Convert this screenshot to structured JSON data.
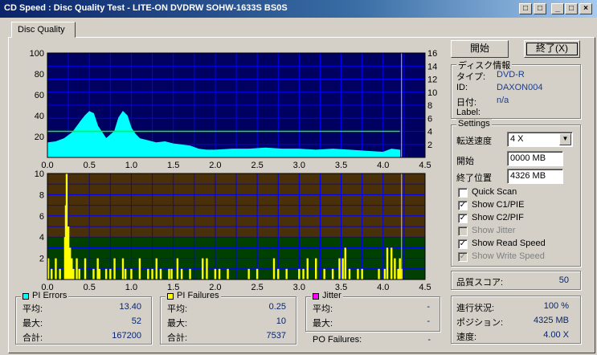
{
  "window": {
    "title": "CD Speed : Disc Quality Test - LITE-ON DVDRW SOHW-1633S BS0S",
    "controls": {
      "restore": "□",
      "minimize": "_",
      "maximize": "□",
      "close": "×"
    }
  },
  "tabs": [
    {
      "label": "Disc Quality"
    }
  ],
  "buttons": {
    "start": "開始",
    "end": "終了(X)"
  },
  "disc_info": {
    "title": "ディスク情報",
    "type_label": "タイプ:",
    "type_value": "DVD-R",
    "id_label": "ID:",
    "id_value": "DAXON004",
    "date_label": "日付:",
    "date_value": "n/a",
    "label_label": "Label:",
    "label_value": ""
  },
  "settings": {
    "title": "Settings",
    "speed_label": "転送速度",
    "speed_value": "4 X",
    "start_label": "開始",
    "start_value": "0000 MB",
    "end_label": "終了位置",
    "end_value": "4326 MB",
    "checkboxes": [
      {
        "label": "Quick Scan",
        "checked": false,
        "enabled": true
      },
      {
        "label": "Show C1/PIE",
        "checked": true,
        "enabled": true
      },
      {
        "label": "Show C2/PIF",
        "checked": true,
        "enabled": true
      },
      {
        "label": "Show Jitter",
        "checked": false,
        "enabled": false
      },
      {
        "label": "Show Read Speed",
        "checked": true,
        "enabled": true
      },
      {
        "label": "Show Write Speed",
        "checked": true,
        "enabled": false
      }
    ]
  },
  "quality": {
    "label": "品質スコア:",
    "value": "50"
  },
  "progress": {
    "progress_label": "進行状況:",
    "progress_value": "100 %",
    "position_label": "ポジション:",
    "position_value": "4325 MB",
    "speed_label": "速度:",
    "speed_value": "4.00 X"
  },
  "pi_errors": {
    "title": "PI Errors",
    "color": "#00ffff",
    "avg_label": "平均:",
    "avg_value": "13.40",
    "max_label": "最大:",
    "max_value": "52",
    "total_label": "合計:",
    "total_value": "167200"
  },
  "pi_failures": {
    "title": "PI Failures",
    "color": "#ffff00",
    "avg_label": "平均:",
    "avg_value": "0.25",
    "max_label": "最大:",
    "max_value": "10",
    "total_label": "合計:",
    "total_value": "7537"
  },
  "jitter": {
    "title": "Jitter",
    "color": "#ff00ff",
    "avg_label": "平均:",
    "avg_value": "-",
    "max_label": "最大:",
    "max_value": "-"
  },
  "po_failures": {
    "label": "PO Failures:",
    "value": "-"
  },
  "chart_data": [
    {
      "type": "area",
      "x_ticks": [
        "0.0",
        "0.5",
        "1.0",
        "1.5",
        "2.0",
        "2.5",
        "3.0",
        "3.5",
        "4.0",
        "4.5"
      ],
      "y_ticks_left": [
        "100",
        "80",
        "60",
        "40",
        "20"
      ],
      "y_ticks_right": [
        "16",
        "14",
        "12",
        "10",
        "8",
        "6",
        "4",
        "2"
      ],
      "xlim": [
        0,
        4.5
      ],
      "ylim": [
        0,
        100
      ],
      "y2lim": [
        0,
        16
      ],
      "colors": {
        "background": "#000060",
        "grid": "#0000ff",
        "series": "#00ffff",
        "speed": "#00ff00"
      },
      "series": [
        {
          "x": [
            0.0,
            0.1,
            0.2,
            0.3,
            0.4,
            0.45,
            0.5,
            0.55,
            0.6,
            0.7,
            0.8,
            0.85,
            0.9,
            0.95,
            1.0,
            1.05,
            1.1,
            1.2,
            1.3,
            1.4,
            1.5,
            1.6,
            1.7,
            1.8,
            1.9,
            2.0,
            2.2,
            2.4,
            2.6,
            2.8,
            3.0,
            3.2,
            3.4,
            3.6,
            3.8,
            4.0,
            4.1,
            4.2
          ],
          "values": [
            14,
            15,
            18,
            24,
            35,
            40,
            44,
            42,
            30,
            18,
            25,
            38,
            44,
            40,
            28,
            22,
            18,
            16,
            14,
            15,
            13,
            12,
            11,
            8,
            7,
            7,
            8,
            8,
            9,
            8,
            8,
            7,
            8,
            7,
            6,
            5,
            8,
            7
          ]
        },
        {
          "x": [
            0.0,
            4.2
          ],
          "values": [
            4,
            4
          ]
        }
      ],
      "cursor_x": 4.22
    },
    {
      "type": "bar",
      "x_ticks": [
        "0.0",
        "0.5",
        "1.0",
        "1.5",
        "2.0",
        "2.5",
        "3.0",
        "3.5",
        "4.0",
        "4.5"
      ],
      "y_ticks_left": [
        "10",
        "8",
        "6",
        "4",
        "2"
      ],
      "xlim": [
        0,
        4.5
      ],
      "ylim": [
        0,
        10
      ],
      "colors": {
        "bg_low": "#004000",
        "bg_high": "#4a3008",
        "grid": "#0000ff",
        "series": "#ffff00"
      },
      "series": [
        {
          "x": [
            0.01,
            0.05,
            0.1,
            0.15,
            0.21,
            0.22,
            0.23,
            0.24,
            0.25,
            0.27,
            0.29,
            0.31,
            0.35,
            0.38,
            0.45,
            0.55,
            0.6,
            0.62,
            0.7,
            0.75,
            0.8,
            0.9,
            0.93,
            1.0,
            1.1,
            1.2,
            1.25,
            1.3,
            1.35,
            1.45,
            1.48,
            1.55,
            1.6,
            1.7,
            1.85,
            1.9,
            2.0,
            2.05,
            2.15,
            2.4,
            2.5,
            2.7,
            2.75,
            2.85,
            3.0,
            3.05,
            3.1,
            3.2,
            3.3,
            3.4,
            3.48,
            3.52,
            3.55,
            3.6,
            3.7,
            3.75,
            3.95,
            4.02,
            4.05,
            4.1,
            4.14,
            4.18,
            4.2,
            4.22
          ],
          "values": [
            2,
            1,
            2,
            1,
            4,
            7,
            10,
            4,
            5,
            3,
            2,
            1,
            2,
            1,
            2,
            1,
            2,
            1,
            1,
            1,
            2,
            2,
            1,
            1,
            2,
            1,
            1,
            2,
            1,
            1,
            1,
            2,
            1,
            1,
            2,
            2,
            1,
            1,
            1,
            1,
            1,
            2,
            1,
            1,
            1,
            1,
            2,
            2,
            1,
            1,
            2,
            2,
            3,
            1,
            1,
            1,
            1,
            1,
            3,
            3,
            2,
            1,
            2,
            1
          ]
        }
      ],
      "cursor_x": 4.22
    }
  ]
}
